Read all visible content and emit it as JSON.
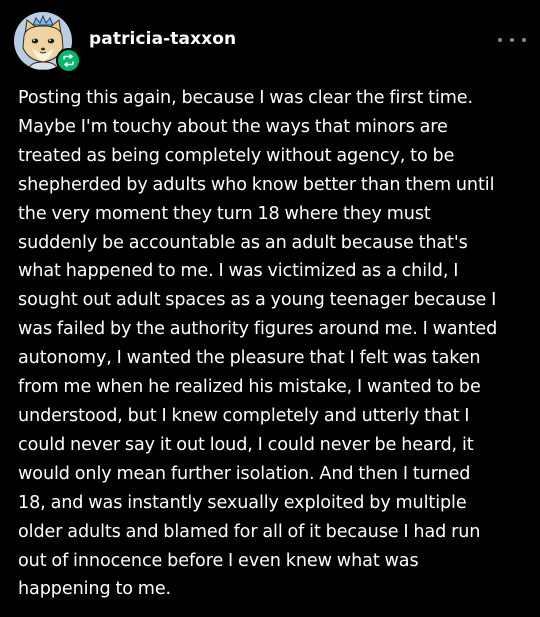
{
  "post": {
    "username": "patricia-taxxon",
    "avatar": "fox-character-avatar",
    "reblog_badge_icon": "reblog-icon",
    "more_icon": "more-options-icon",
    "accent_color": "#00b86b",
    "body_lines": [
      "Posting this again, because I was clear the first time.",
      "Maybe I'm touchy about the ways that minors are",
      "treated as being completely without agency, to be",
      "shepherded by adults who know better than them until",
      "the very moment they turn 18 where they must",
      "suddenly be accountable as an adult because that's",
      "what happened to me. I was victimized as a child, I",
      "sought out adult spaces as a young teenager because I",
      "was failed by the authority figures around me. I wanted",
      "autonomy, I wanted the pleasure that I felt was taken",
      "from me when he realized his mistake, I wanted to be",
      "understood, but I knew completely and utterly that I",
      "could never say it out loud, I could never be heard, it",
      "would only mean further isolation. And then I turned",
      "18, and was instantly sexually exploited by multiple",
      "older adults and blamed for all of it because I had run",
      "out of innocence before I even knew what was",
      "happening to me."
    ]
  }
}
